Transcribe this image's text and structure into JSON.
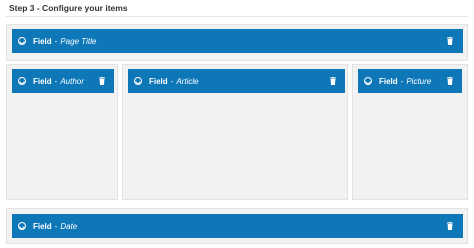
{
  "step": {
    "title": "Step 3 - Configure your items"
  },
  "fields": {
    "prefix": "Field",
    "separator": "-",
    "page_title": "Page Title",
    "author": "Author",
    "article": "Article",
    "picture": "Picture",
    "date": "Date"
  },
  "colors": {
    "bar": "#0d77b8",
    "zone": "#f2f2f2"
  },
  "icons": {
    "collapse": "collapse-circle-icon",
    "delete": "trash-icon"
  }
}
